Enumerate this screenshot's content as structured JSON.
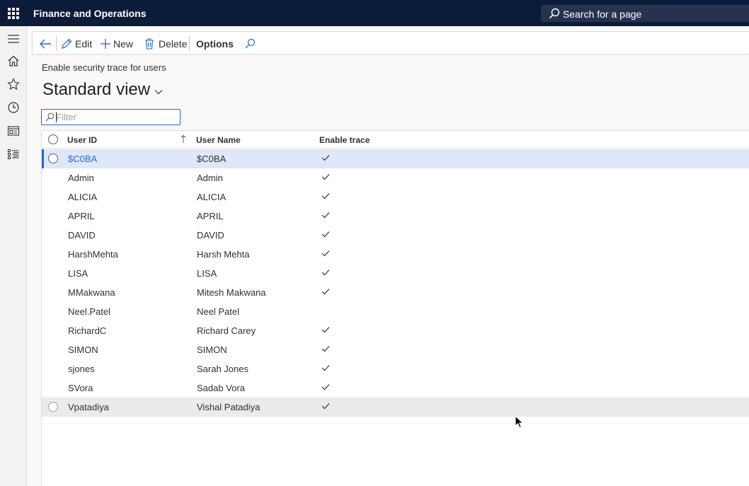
{
  "topbar": {
    "app_title": "Finance and Operations",
    "search_text": "Search for a page"
  },
  "actionpane": {
    "edit": "Edit",
    "new": "New",
    "delete": "Delete",
    "options": "Options"
  },
  "page": {
    "caption": "Enable security trace for users",
    "view_title": "Standard view"
  },
  "filter": {
    "placeholder": "Filter"
  },
  "grid": {
    "columns": {
      "user_id": "User ID",
      "user_name": "User Name",
      "enable_trace": "Enable trace"
    },
    "sort": "ascending",
    "rows": [
      {
        "user_id": "$C0BA",
        "user_name": "$C0BA",
        "trace": true
      },
      {
        "user_id": "Admin",
        "user_name": "Admin",
        "trace": true
      },
      {
        "user_id": "ALICIA",
        "user_name": "ALICIA",
        "trace": true
      },
      {
        "user_id": "APRIL",
        "user_name": "APRIL",
        "trace": true
      },
      {
        "user_id": "DAVID",
        "user_name": "DAVID",
        "trace": true
      },
      {
        "user_id": "HarshMehta",
        "user_name": "Harsh Mehta",
        "trace": true
      },
      {
        "user_id": "LISA",
        "user_name": "LISA",
        "trace": true
      },
      {
        "user_id": "MMakwana",
        "user_name": "Mitesh Makwana",
        "trace": true
      },
      {
        "user_id": "Neel.Patel",
        "user_name": "Neel Patel",
        "trace": false
      },
      {
        "user_id": "RichardC",
        "user_name": "Richard Carey",
        "trace": true
      },
      {
        "user_id": "SIMON",
        "user_name": "SIMON",
        "trace": true
      },
      {
        "user_id": "sjones",
        "user_name": "Sarah Jones",
        "trace": true
      },
      {
        "user_id": "SVora",
        "user_name": "Sadab Vora",
        "trace": true
      },
      {
        "user_id": "Vpatadiya",
        "user_name": "Vishal Patadiya",
        "trace": true
      }
    ]
  },
  "colors": {
    "nav_bg": "#0b1b3a",
    "accent": "#2266e3",
    "selected_row": "#dee8fa"
  }
}
